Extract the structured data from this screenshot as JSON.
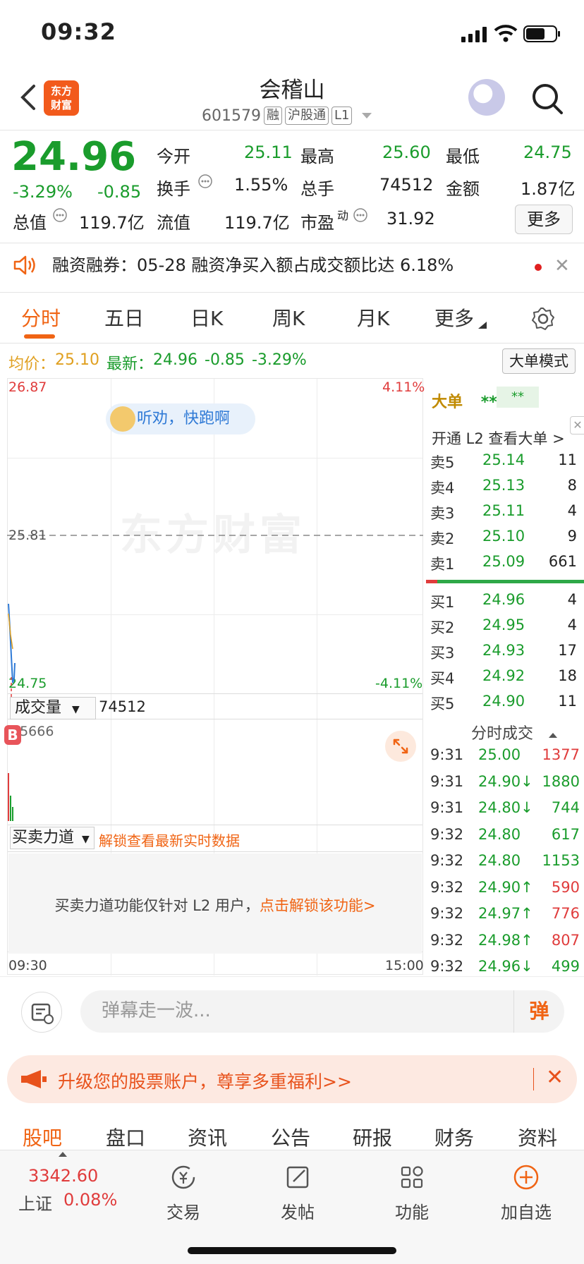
{
  "status_bar": {
    "time": "09:32"
  },
  "header": {
    "logo_line1": "东方",
    "logo_line2": "财富",
    "stock_name": "会稽山",
    "stock_code": "601579",
    "tags": [
      "融",
      "沪股通",
      "L1"
    ]
  },
  "quote": {
    "price": "24.96",
    "change_pct": "-3.29%",
    "change": "-0.85",
    "open_label": "今开",
    "open": "25.11",
    "high_label": "最高",
    "high": "25.60",
    "low_label": "最低",
    "low": "24.75",
    "turnover_label": "换手",
    "turnover": "1.55%",
    "volume_label": "总手",
    "volume": "74512",
    "amount_label": "金额",
    "amount": "1.87亿",
    "mktcap_label": "总值",
    "mktcap": "119.7亿",
    "float_label": "流值",
    "float": "119.7亿",
    "pe_label": "市盈",
    "pe_sup": "动",
    "pe": "31.92",
    "more": "更多"
  },
  "notice": {
    "text": "融资融券：05-28 融资净买入额占成交额比达 6.18%"
  },
  "chart_tabs": [
    "分时",
    "五日",
    "日K",
    "周K",
    "月K",
    "更多"
  ],
  "chart_header": {
    "avg_label": "均价：",
    "avg": "25.10",
    "latest_label": "最新：",
    "latest": "24.96",
    "latest_change": "-0.85",
    "latest_pct": "-3.29%",
    "mode_button": "大单模式"
  },
  "intraday": {
    "y_top": "26.87",
    "y_mid": "25.81",
    "y_bottom": "24.75",
    "pct_top": "4.11%",
    "pct_bottom": "-4.11%",
    "bubble": "听劝，快跑啊",
    "watermark": "东方财富",
    "volume_label": "成交量",
    "volume_value": "74512",
    "volume_max": "25666",
    "bs_marker": "B",
    "bs_label": "买卖力道",
    "bs_unlock": "解锁查看最新实时数据",
    "lock_text": "买卖力道功能仅针对 L2 用户，",
    "lock_link": "点击解锁该功能>",
    "time_start": "09:30",
    "time_end": "15:00"
  },
  "order_book": {
    "title": "大单",
    "stars1": "**",
    "stars2": "**",
    "open_l2": "开通 L2 查看大单 >",
    "asks": [
      {
        "label": "卖5",
        "price": "25.14",
        "qty": "11"
      },
      {
        "label": "卖4",
        "price": "25.13",
        "qty": "8"
      },
      {
        "label": "卖3",
        "price": "25.11",
        "qty": "4"
      },
      {
        "label": "卖2",
        "price": "25.10",
        "qty": "9"
      },
      {
        "label": "卖1",
        "price": "25.09",
        "qty": "661"
      }
    ],
    "bids": [
      {
        "label": "买1",
        "price": "24.96",
        "qty": "4"
      },
      {
        "label": "买2",
        "price": "24.95",
        "qty": "4"
      },
      {
        "label": "买3",
        "price": "24.93",
        "qty": "17"
      },
      {
        "label": "买4",
        "price": "24.92",
        "qty": "18"
      },
      {
        "label": "买5",
        "price": "24.90",
        "qty": "11"
      }
    ],
    "ticks_title": "分时成交",
    "ticks": [
      {
        "time": "9:31",
        "price": "25.00",
        "arrow": "",
        "qty": "1377",
        "color": "red"
      },
      {
        "time": "9:31",
        "price": "24.90↓",
        "arrow": "",
        "qty": "1880",
        "color": "green"
      },
      {
        "time": "9:31",
        "price": "24.80↓",
        "arrow": "",
        "qty": "744",
        "color": "green"
      },
      {
        "time": "9:32",
        "price": "24.80",
        "arrow": "",
        "qty": "617",
        "color": "green"
      },
      {
        "time": "9:32",
        "price": "24.80",
        "arrow": "",
        "qty": "1153",
        "color": "green"
      },
      {
        "time": "9:32",
        "price": "24.90↑",
        "arrow": "",
        "qty": "590",
        "color": "red"
      },
      {
        "time": "9:32",
        "price": "24.97↑",
        "arrow": "",
        "qty": "776",
        "color": "red"
      },
      {
        "time": "9:32",
        "price": "24.98↑",
        "arrow": "",
        "qty": "807",
        "color": "red"
      },
      {
        "time": "9:32",
        "price": "24.96↓",
        "arrow": "",
        "qty": "499",
        "color": "green"
      }
    ]
  },
  "danmaku": {
    "placeholder": "弹幕走一波...",
    "send": "弹"
  },
  "promo": {
    "text": "升级您的股票账户，尊享多重福利>>"
  },
  "sub_tabs": [
    "股吧",
    "盘口",
    "资讯",
    "公告",
    "研报",
    "财务",
    "资料"
  ],
  "bottom_bar": {
    "index_value": "3342.60",
    "index_name": "上证",
    "index_pct": "0.08%",
    "items": [
      "交易",
      "发帖",
      "功能",
      "加自选"
    ]
  },
  "colors": {
    "accent": "#f06414",
    "up": "#e03c3c",
    "down": "#1a9c2c"
  }
}
